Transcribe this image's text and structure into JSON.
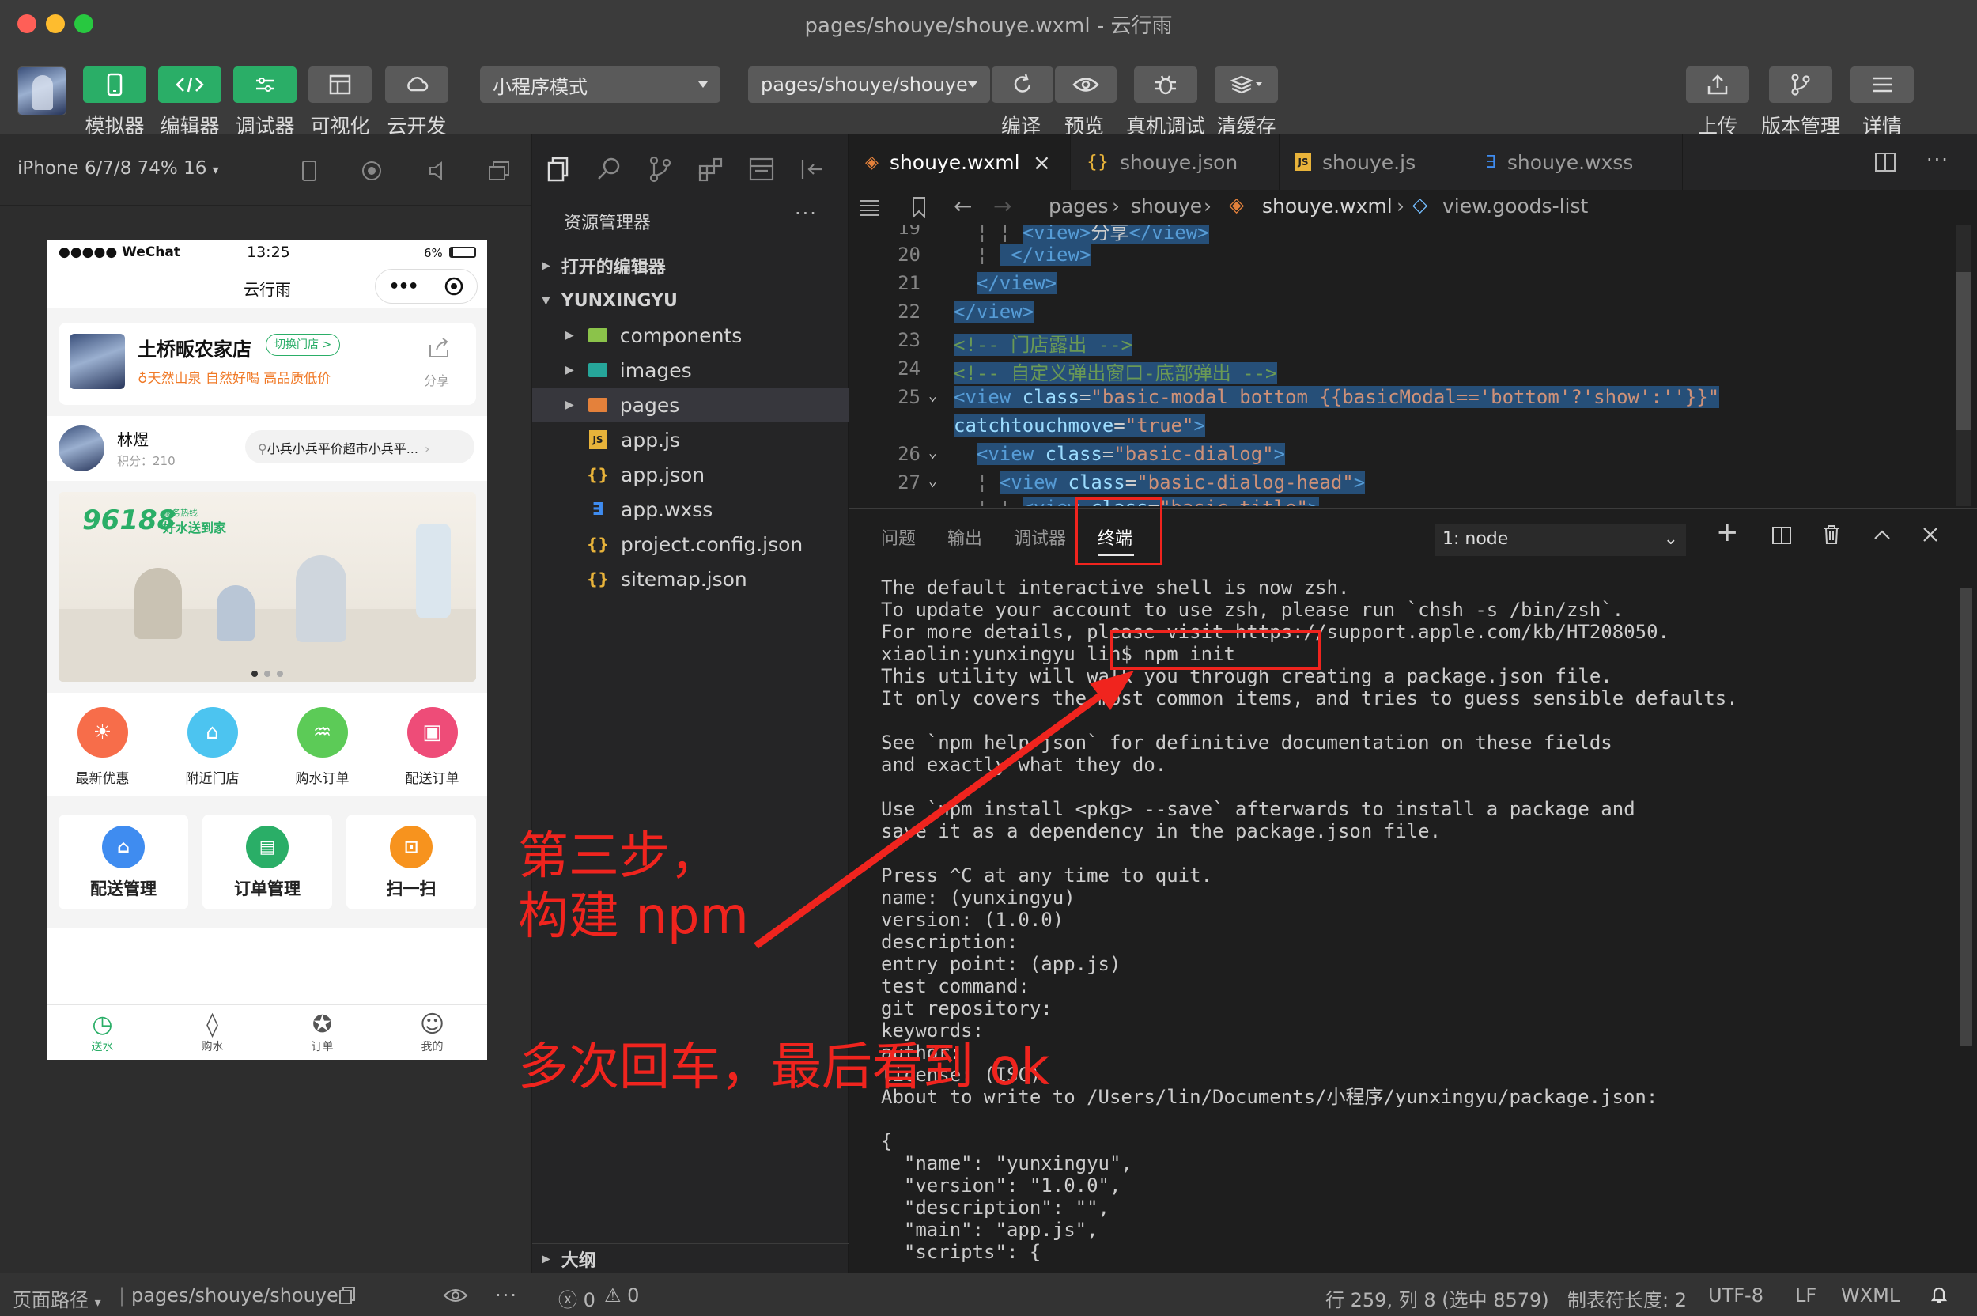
{
  "window": {
    "title": "pages/shouye/shouye.wxml - 云行雨"
  },
  "toolbar": {
    "left_buttons": [
      "模拟器",
      "编辑器",
      "调试器",
      "可视化",
      "云开发"
    ],
    "mode_dropdown": "小程序模式",
    "page_dropdown": "pages/shouye/shouye",
    "center_buttons": [
      "编译",
      "预览",
      "真机调试",
      "清缓存"
    ],
    "right_buttons": [
      "上传",
      "版本管理",
      "详情"
    ]
  },
  "simulator": {
    "device_label": "iPhone 6/7/8 74% 16",
    "status": {
      "carrier": "●●●●● WeChat",
      "time": "13:25",
      "battery": "6%"
    },
    "nav_title": "云行雨",
    "shop": {
      "name": "土桥畈农家店",
      "switch": "切换门店 >",
      "tagline": "天然山泉 自然好喝 高品质低价",
      "share": "分享"
    },
    "user": {
      "name": "林煜",
      "points": "积分：210",
      "store": "小兵小兵平价超市小兵平..."
    },
    "banner": {
      "number": "96188",
      "slogan_top": "服务热线",
      "slogan": "好水送到家"
    },
    "quick": [
      "最新优惠",
      "附近门店",
      "购水订单",
      "配送订单"
    ],
    "tiles": [
      "配送管理",
      "订单管理",
      "扫一扫"
    ],
    "tabs": [
      "送水",
      "购水",
      "订单",
      "我的"
    ]
  },
  "explorer": {
    "title": "资源管理器",
    "open_editors": "打开的编辑器",
    "root": "YUNXINGYU",
    "folders": [
      "components",
      "images",
      "pages"
    ],
    "files": [
      "app.js",
      "app.json",
      "app.wxss",
      "project.config.json",
      "sitemap.json"
    ],
    "outline": "大纲"
  },
  "editor": {
    "tabs": [
      "shouye.wxml",
      "shouye.json",
      "shouye.js",
      "shouye.wxss"
    ],
    "breadcrumb": [
      "pages",
      "shouye",
      "shouye.wxml",
      "view.goods-list"
    ],
    "line_numbers": [
      "19",
      "20",
      "21",
      "22",
      "23",
      "24",
      "25",
      "",
      "26",
      "27"
    ]
  },
  "terminal": {
    "tabs": [
      "问题",
      "输出",
      "调试器",
      "终端"
    ],
    "shell": "1: node",
    "lines": [
      "The default interactive shell is now zsh.",
      "To update your account to use zsh, please run `chsh -s /bin/zsh`.",
      "For more details, please visit https://support.apple.com/kb/HT208050.",
      "xiaolin:yunxingyu lin$ npm init",
      "This utility will walk you through creating a package.json file.",
      "It only covers the most common items, and tries to guess sensible defaults.",
      "",
      "See `npm help json` for definitive documentation on these fields",
      "and exactly what they do.",
      "",
      "Use `npm install <pkg> --save` afterwards to install a package and",
      "save it as a dependency in the package.json file.",
      "",
      "Press ^C at any time to quit.",
      "name: (yunxingyu)",
      "version: (1.0.0)",
      "description:",
      "entry point: (app.js)",
      "test command:",
      "git repository:",
      "keywords:",
      "author:",
      "license: (ISC)",
      "About to write to /Users/lin/Documents/小程序/yunxingyu/package.json:",
      "",
      "{",
      "  \"name\": \"yunxingyu\",",
      "  \"version\": \"1.0.0\",",
      "  \"description\": \"\",",
      "  \"main\": \"app.js\",",
      "  \"scripts\": {"
    ]
  },
  "annotations": {
    "step_line1": "第三步，",
    "step_line2": "构建 npm",
    "note": "多次回车，最后看到 ok"
  },
  "statusbar": {
    "page_path_label": "页面路径",
    "page_path": "pages/shouye/shouye",
    "errors": "0",
    "warnings": "0",
    "position": "行 259, 列 8 (选中 8579)",
    "tab_size": "制表符长度: 2",
    "encoding": "UTF-8",
    "eol": "LF",
    "language": "WXML"
  },
  "colors": {
    "accent_green": "#2aae67",
    "annotation_red": "#f0241e",
    "selection_blue": "#264f78"
  }
}
